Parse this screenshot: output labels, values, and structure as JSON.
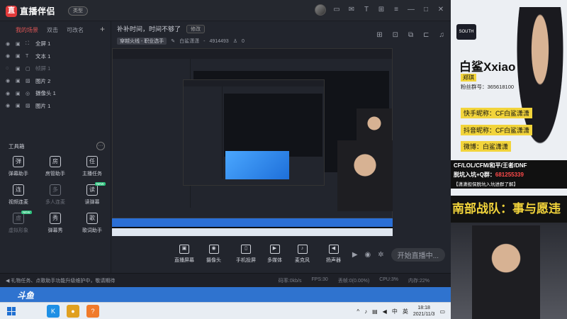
{
  "app": {
    "logo_mark": "直",
    "logo_text": "直播伴侣",
    "type_button": "类型",
    "title_icons": [
      "chat-icon",
      "mail-icon",
      "shirt-icon",
      "grid-icon",
      "settings-icon",
      "minimize-icon",
      "maximize-icon",
      "close-icon"
    ]
  },
  "scene_tabs": [
    {
      "label": "我的场景",
      "active": true
    },
    {
      "label": "双击",
      "active": false
    },
    {
      "label": "可改名",
      "active": false
    }
  ],
  "scene_add": "+",
  "layers": [
    {
      "label": "全屏 1",
      "dim": false
    },
    {
      "label": "文本 1",
      "dim": false
    },
    {
      "label": "帧屏 1",
      "dim": true
    },
    {
      "label": "图片 2",
      "dim": false
    },
    {
      "label": "摄像头 1",
      "dim": false
    },
    {
      "label": "图片 1",
      "dim": false
    }
  ],
  "tools_title": "工具箱",
  "tools_more": "···",
  "tools": [
    {
      "label": "弹幕助手",
      "icon": "弹",
      "dim": false
    },
    {
      "label": "房管助手",
      "icon": "房",
      "dim": false
    },
    {
      "label": "主播任务",
      "icon": "任",
      "dim": false
    },
    {
      "label": "视频连麦",
      "icon": "连",
      "dim": false
    },
    {
      "label": "多人连麦",
      "icon": "多",
      "dim": true
    },
    {
      "label": "读弹幕",
      "icon": "读",
      "dim": false,
      "tag": "NEW"
    },
    {
      "label": "虚拟形象",
      "icon": "虚",
      "dim": true,
      "tag": "NEW"
    },
    {
      "label": "弹幕秀",
      "icon": "秀",
      "dim": false
    },
    {
      "label": "歌词助手",
      "icon": "歌",
      "dim": false
    }
  ],
  "info": {
    "title": "补补时间，时间不够了",
    "edit_label": "修改",
    "category": "穿越火线 - 职业选手",
    "host": "白鲨潇潇",
    "room_id": "4914493",
    "viewers": "0"
  },
  "info_icons": [
    "share-icon",
    "lock-icon",
    "copy-icon",
    "link-icon",
    "bell-icon"
  ],
  "toolbar": {
    "items": [
      {
        "label": "直播屏幕",
        "icon": "▣"
      },
      {
        "label": "摄像头",
        "icon": "◉"
      },
      {
        "label": "手机投屏",
        "icon": "▯"
      },
      {
        "label": "多媒体",
        "icon": "▶"
      },
      {
        "label": "麦克风",
        "icon": "♪"
      },
      {
        "label": "扬声器",
        "icon": "◀"
      }
    ],
    "start_label": "开始直播中..."
  },
  "status": {
    "prefix": "礼物任务、",
    "message": "点歌助手功能升级维护中，敬请期待",
    "stats": [
      "码率:0kb/s",
      "FPS:30",
      "丢帧:0(0.00%)",
      "CPU:3%",
      "内存:22%"
    ]
  },
  "overlay": {
    "team_logo": "SOUTH",
    "name": "白鲨Xxiao",
    "real_name": "郑琪",
    "fans": "粉丝群号：365618100",
    "kuaishou": "快手昵称：CF白鲨潇潇",
    "douyin": "抖音昵称：CF白鲨潇潇",
    "weibo": "微博：白鲨潇潇",
    "games": "CF/LOL/CFM/和平/王者/DNF",
    "qq_prefix": "脱坑入坑+Q群：",
    "qq_num": "681255339",
    "note": "【潇潇担保脱坑入坑进群了解】",
    "team": "南部战队：事与愿违"
  },
  "douyu_logo": "斗鱼",
  "taskbar": {
    "apps": [
      {
        "icon": "K",
        "color": "#1d8fe5"
      },
      {
        "icon": "●",
        "color": "#e0a020"
      },
      {
        "icon": "?",
        "color": "#f07a2a"
      }
    ],
    "tray": [
      "^",
      "中",
      "英"
    ],
    "time": "18:18",
    "date": "2021/11/3"
  }
}
